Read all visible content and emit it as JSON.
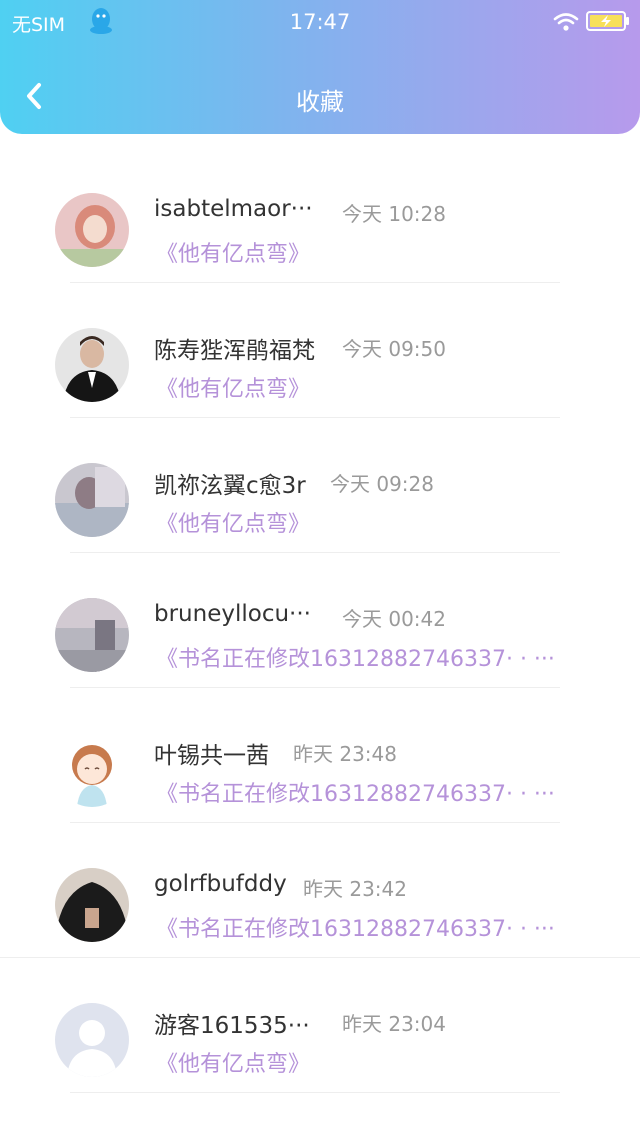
{
  "status_bar": {
    "carrier": "无SIM",
    "time": "17:47"
  },
  "nav": {
    "title": "收藏"
  },
  "favorites": [
    {
      "name": "isabtelmaor···",
      "time": "今天 10:28",
      "book": "《他有亿点弯》"
    },
    {
      "name": "陈寿狴浑鹃福梵",
      "time": "今天 09:50",
      "book": "《他有亿点弯》"
    },
    {
      "name": "凯祢泫翼c愈3r",
      "time": "今天 09:28",
      "book": "《他有亿点弯》"
    },
    {
      "name": "bruneyllocu···",
      "time": "今天 00:42",
      "book": "《书名正在修改16312882746337· · ···"
    },
    {
      "name": "叶锡共一茜",
      "time": "昨天 23:48",
      "book": "《书名正在修改16312882746337· · ···"
    },
    {
      "name": "golrfbufddy",
      "time": "昨天 23:42",
      "book": "《书名正在修改16312882746337· · ···"
    },
    {
      "name": "游客161535···",
      "time": "昨天 23:04",
      "book": "《他有亿点弯》"
    }
  ]
}
